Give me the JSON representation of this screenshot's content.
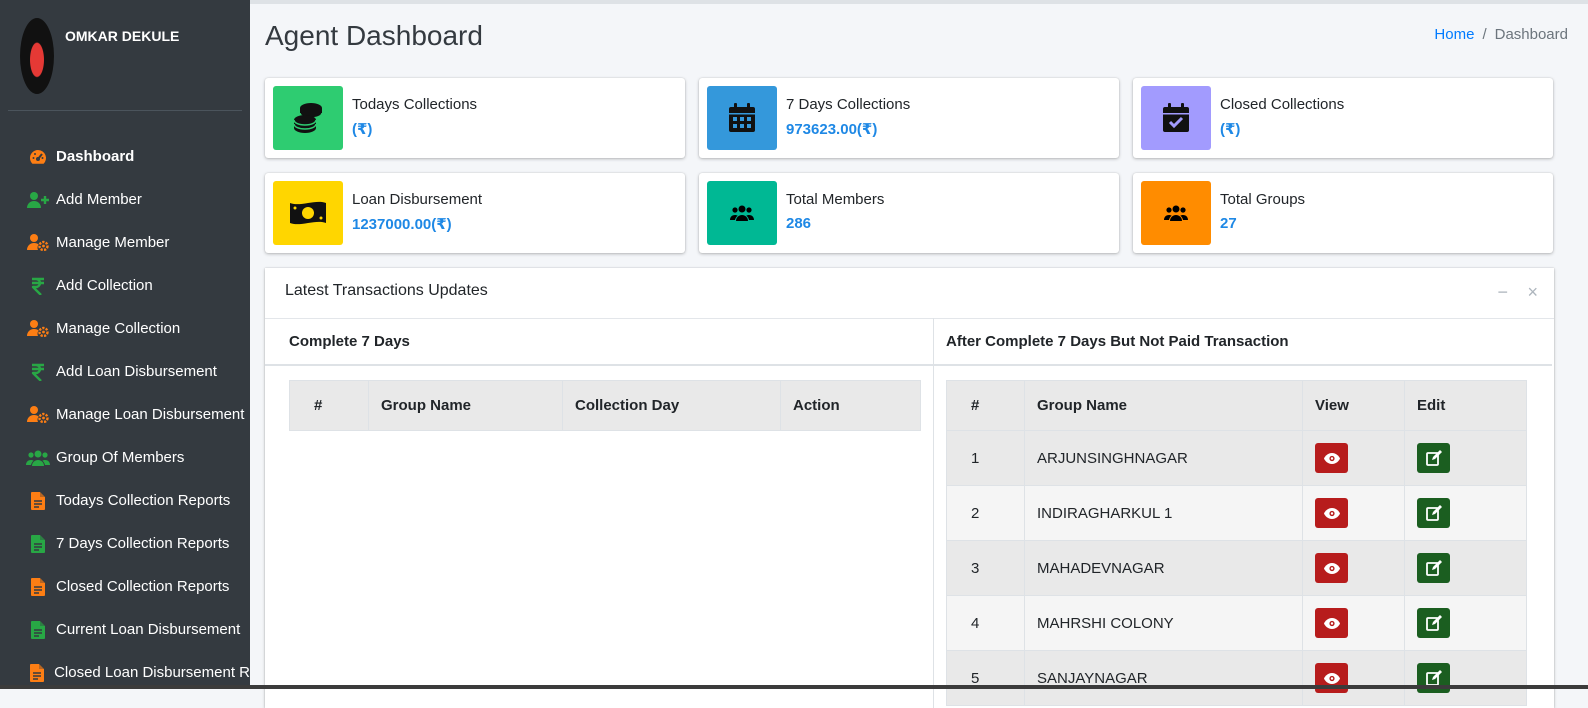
{
  "user": {
    "name": "OMKAR DEKULE"
  },
  "sidebar": {
    "items": [
      {
        "label": "Dashboard",
        "icon": "tachometer-icon",
        "color": "#fd7e14"
      },
      {
        "label": "Add Member",
        "icon": "user-plus-icon",
        "color": "#28a745"
      },
      {
        "label": "Manage Member",
        "icon": "user-gear-icon",
        "color": "#fd7e14"
      },
      {
        "label": "Add Collection",
        "icon": "rupee-icon",
        "color": "#28a745"
      },
      {
        "label": "Manage Collection",
        "icon": "user-gear-icon",
        "color": "#fd7e14"
      },
      {
        "label": "Add Loan Disbursement",
        "icon": "rupee-icon",
        "color": "#28a745"
      },
      {
        "label": "Manage Loan Disbursement",
        "icon": "user-gear-icon",
        "color": "#fd7e14"
      },
      {
        "label": "Group Of Members",
        "icon": "users-icon",
        "color": "#28a745"
      },
      {
        "label": "Todays Collection Reports",
        "icon": "file-icon",
        "color": "#fd7e14"
      },
      {
        "label": "7 Days Collection Reports",
        "icon": "file-icon",
        "color": "#28a745"
      },
      {
        "label": "Closed Collection Reports",
        "icon": "file-icon",
        "color": "#fd7e14"
      },
      {
        "label": "Current Loan Disbursement",
        "icon": "file-icon",
        "color": "#28a745"
      },
      {
        "label": "Closed Loan Disbursement R",
        "icon": "file-icon",
        "color": "#fd7e14"
      }
    ]
  },
  "header": {
    "title": "Agent Dashboard",
    "breadcrumb_home": "Home",
    "breadcrumb_sep": "/",
    "breadcrumb_current": "Dashboard"
  },
  "boxes": [
    {
      "title": "Todays Collections",
      "value": "(₹)",
      "color": "#2ecc71",
      "icon": "coins-icon"
    },
    {
      "title": "7 Days Collections",
      "value": "973623.00(₹)",
      "color": "#3498db",
      "icon": "calendar-icon"
    },
    {
      "title": "Closed Collections",
      "value": "(₹)",
      "color": "#a29bfe",
      "icon": "calendar-check-icon"
    },
    {
      "title": "Loan Disbursement",
      "value": "1237000.00(₹)",
      "color": "#ffd600",
      "icon": "money-bill-icon"
    },
    {
      "title": "Total Members",
      "value": "286",
      "color": "#00b894",
      "icon": "users-icon"
    },
    {
      "title": "Total Groups",
      "value": "27",
      "color": "#ff8c00",
      "icon": "users-icon"
    }
  ],
  "card": {
    "title": "Latest Transactions Updates",
    "minimize": "−",
    "close": "×",
    "left": {
      "heading": "Complete 7 Days",
      "columns": [
        "#",
        "Group Name",
        "Collection Day",
        "Action"
      ]
    },
    "right": {
      "heading": "After Complete 7 Days But Not Paid Transaction",
      "columns": [
        "#",
        "Group Name",
        "View",
        "Edit"
      ],
      "rows": [
        {
          "no": "1",
          "group": "ARJUNSINGHNAGAR"
        },
        {
          "no": "2",
          "group": "INDIRAGHARKUL 1"
        },
        {
          "no": "3",
          "group": "MAHADEVNAGAR"
        },
        {
          "no": "4",
          "group": "MAHRSHI COLONY"
        },
        {
          "no": "5",
          "group": "SANJAYNAGAR"
        }
      ]
    }
  }
}
